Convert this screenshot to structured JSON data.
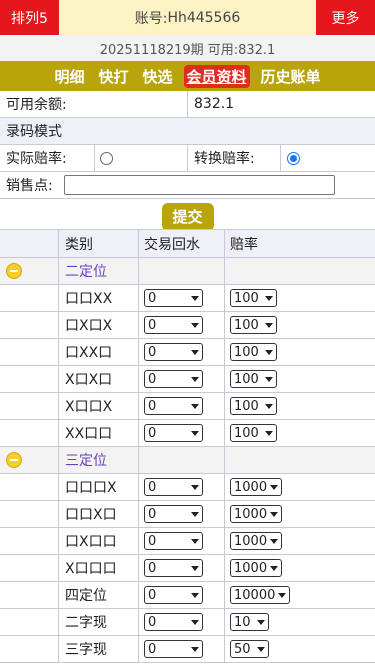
{
  "header": {
    "left_button": "排列5",
    "account_label": "账号:",
    "account_value": "Hh445566",
    "right_button": "更多"
  },
  "period": {
    "text": "20251118219期",
    "balance_text": "可用:832.1"
  },
  "nav": {
    "items": [
      "明细",
      "快打",
      "快选",
      "会员资料",
      "历史账单"
    ],
    "active_index": 3
  },
  "form": {
    "balance_label": "可用余额:",
    "balance_value": "832.1",
    "mode_title": "录码模式",
    "actual_odds_label": "实际赔率:",
    "convert_odds_label": "转换赔率:",
    "sales_point_label": "销售点:",
    "sales_point_value": "",
    "submit_label": "提交"
  },
  "table": {
    "headers": [
      "类别",
      "交易回水",
      "赔率"
    ],
    "groups": [
      {
        "title": "二定位",
        "rows": [
          {
            "name": "口口XX",
            "rebate": "0",
            "odds": "100"
          },
          {
            "name": "口X口X",
            "rebate": "0",
            "odds": "100"
          },
          {
            "name": "口XX口",
            "rebate": "0",
            "odds": "100"
          },
          {
            "name": "X口X口",
            "rebate": "0",
            "odds": "100"
          },
          {
            "name": "X口口X",
            "rebate": "0",
            "odds": "100"
          },
          {
            "name": "XX口口",
            "rebate": "0",
            "odds": "100"
          }
        ]
      },
      {
        "title": "三定位",
        "rows": [
          {
            "name": "口口口X",
            "rebate": "0",
            "odds": "1000"
          },
          {
            "name": "口口X口",
            "rebate": "0",
            "odds": "1000"
          },
          {
            "name": "口X口口",
            "rebate": "0",
            "odds": "1000"
          },
          {
            "name": "X口口口",
            "rebate": "0",
            "odds": "1000"
          },
          {
            "name": "四定位",
            "rebate": "0",
            "odds": "10000"
          },
          {
            "name": "二字现",
            "rebate": "0",
            "odds": "10"
          },
          {
            "name": "三字现",
            "rebate": "0",
            "odds": "50"
          }
        ]
      }
    ]
  },
  "colors": {
    "accent_red": "#e5161c",
    "nav_gold": "#b9a40b",
    "header_bg": "#fbf3c3",
    "radio_blue": "#1676f3"
  }
}
